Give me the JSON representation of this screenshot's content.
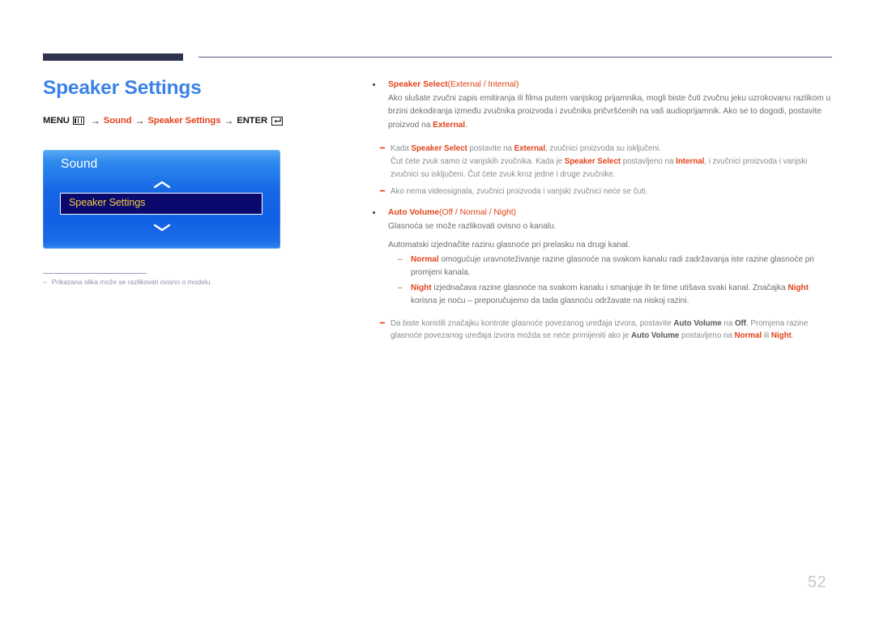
{
  "document": {
    "page_number": "52",
    "title": "Speaker Settings",
    "title_color": "#3b82e8",
    "accent_color": "#e0441b",
    "header_bar_color": "#2e3350"
  },
  "menu_path": {
    "menu_label": "MENU",
    "menu_icon": "menu-bars-icon",
    "arrow": "→",
    "step1": "Sound",
    "step2": "Speaker Settings",
    "enter_label": "ENTER",
    "enter_icon": "enter-return-icon"
  },
  "osd": {
    "title": "Sound",
    "up_icon": "chevron-up-icon",
    "down_icon": "chevron-down-icon",
    "selected_item": "Speaker Settings"
  },
  "left_footnote": {
    "dash": "–",
    "text": "Prikazana slika može se razlikovati ovisno o modelu."
  },
  "content": {
    "speaker_select": {
      "bullet": "•",
      "title": "Speaker Select",
      "options": "(External / Internal)",
      "paragraph_1": "Ako slušate zvučni zapis emitiranja ili filma putem vanjskog prijamnika, mogli biste čuti zvučnu jeku uzrokovanu razlikom u brzini dekodiranja između zvučnika proizvoda i zvučnika pričvršćenih na vaš audioprijamnik. Ako se to dogodi, postavite proizvod na ",
      "paragraph_1_bold": "External",
      "paragraph_1_end": ".",
      "note_1_part_a": "Kada ",
      "note_1_b1": "Speaker Select",
      "note_1_part_b": " postavite na ",
      "note_1_b2": "External",
      "note_1_part_c": ", zvučnici proizvoda su isključeni.",
      "note_1_line2_a": "Čut ćete zvuk samo iz vanjskih zvučnika. Kada je ",
      "note_1_line2_b1": "Speaker Select",
      "note_1_line2_b": " postavljeno na ",
      "note_1_line2_b2": "Internal",
      "note_1_line2_c": ", i zvučnici proizvoda i vanjski zvučnici su isključeni. Čut ćete zvuk kroz jedne i druge zvučnike.",
      "note_2": "Ako nema videosignala, zvučnici proizvoda i vanjski zvučnici neće se čuti."
    },
    "auto_volume": {
      "bullet": "•",
      "title": "Auto Volume",
      "options": "(Off / Normal / Night)",
      "paragraph_1": "Glasnoća se može razlikovati ovisno o kanalu.",
      "paragraph_2": "Automatski izjednačite razinu glasnoće pri prelasku na drugi kanal.",
      "sub_1_dash": "–",
      "sub_1_bold": "Normal",
      "sub_1_text": " omogućuje uravnoteživanje razine glasnoće na svakom kanalu radi zadržavanja iste razine glasnoće pri promjeni kanala.",
      "sub_2_dash": "–",
      "sub_2_bold": "Night",
      "sub_2_text_a": " izjednačava razine glasnoće na svakom kanalu i smanjuje ih te time utišava svaki kanal. Značajka ",
      "sub_2_bold2": "Night",
      "sub_2_text_b": " korisna je noću – preporučujemo da tada glasnoću održavate na niskoj razini.",
      "note_a": "Da biste koristili značajku kontrole glasnoće povezanog uređaja izvora, postavite ",
      "note_b1": "Auto Volume",
      "note_b": " na ",
      "note_b2": "Off",
      "note_c": ". Promjena razine glasnoće povezanog uređaja izvora možda se neće primijeniti ako je ",
      "note_b3": "Auto Volume",
      "note_d": " postavljeno na ",
      "note_b4": "Normal",
      "note_e": " ili ",
      "note_b5": "Night",
      "note_f": "."
    }
  }
}
